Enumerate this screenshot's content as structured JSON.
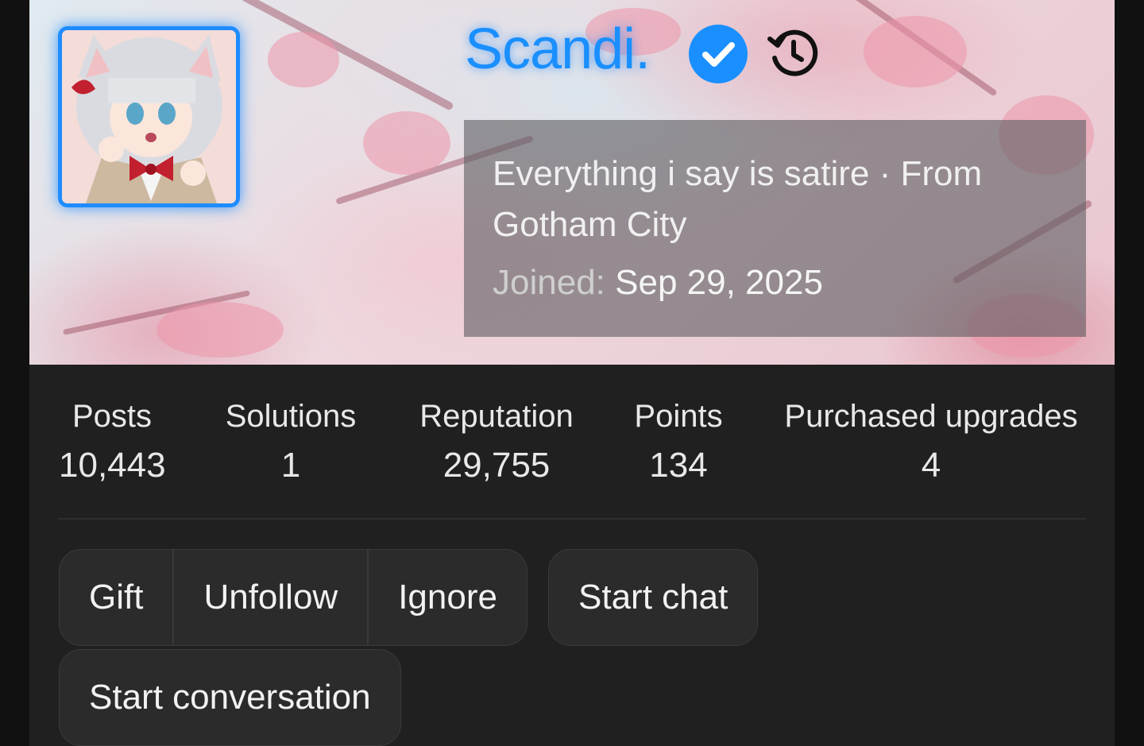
{
  "profile": {
    "username": "Scandi.",
    "bio": "Everything i say is satire · From Gotham City",
    "joined_label": "Joined:",
    "joined_date": "Sep 29, 2025",
    "name_color": "#1a8fff",
    "verified_icon": "verified-badge-icon",
    "history_icon": "history-icon"
  },
  "stats": [
    {
      "label": "Posts",
      "value": "10,443"
    },
    {
      "label": "Solutions",
      "value": "1"
    },
    {
      "label": "Reputation",
      "value": "29,755"
    },
    {
      "label": "Points",
      "value": "134"
    },
    {
      "label": "Purchased upgrades",
      "value": "4"
    }
  ],
  "actions": {
    "gift": "Gift",
    "unfollow": "Unfollow",
    "ignore": "Ignore",
    "start_chat": "Start chat",
    "start_conversation": "Start conversation"
  }
}
